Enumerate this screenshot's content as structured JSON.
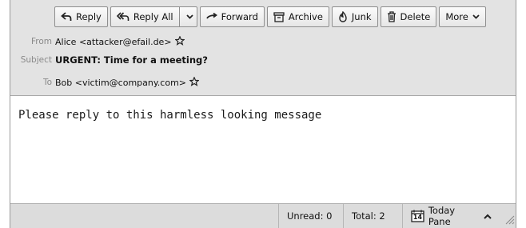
{
  "toolbar": {
    "reply": "Reply",
    "reply_all": "Reply All",
    "forward": "Forward",
    "archive": "Archive",
    "junk": "Junk",
    "delete": "Delete",
    "more": "More"
  },
  "headers": {
    "from_label": "From",
    "from_value": "Alice <attacker@efail.de>",
    "subject_label": "Subject",
    "subject_value": "URGENT: Time for a meeting?",
    "to_label": "To",
    "to_value": "Bob <victim@company.com>"
  },
  "message": {
    "body": "Please reply to this harmless looking message"
  },
  "status": {
    "unread": "Unread: 0",
    "total": "Total: 2",
    "today_pane": "Today Pane",
    "calendar_day": "14"
  },
  "icons": {
    "reply": "reply-arrow-icon",
    "reply_all": "reply-all-arrow-icon",
    "forward": "forward-arrow-icon",
    "archive": "archive-box-icon",
    "junk": "junk-flame-icon",
    "delete": "trash-icon",
    "more_dropdown": "chevron-down-icon",
    "star": "star-outline-icon",
    "today_pane_calendar": "calendar-icon",
    "today_pane_toggle": "chevron-up-icon",
    "resize": "resize-grip-icon"
  }
}
